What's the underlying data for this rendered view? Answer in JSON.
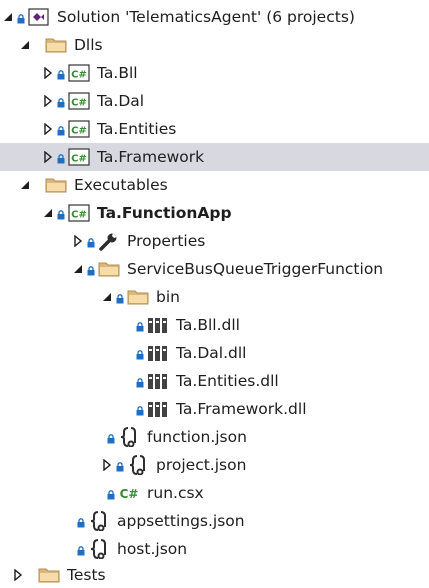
{
  "solution_explorer": {
    "items": [
      {
        "label": "Solution 'TelematicsAgent' (6 projects)",
        "icon": "visual-studio-solution-icon",
        "expander": "expanded",
        "lock": true
      },
      {
        "label": "Dlls",
        "icon": "folder-icon",
        "expander": "expanded",
        "lock": false
      },
      {
        "label": "Ta.Bll",
        "icon": "csharp-project-icon",
        "expander": "collapsed",
        "lock": true
      },
      {
        "label": "Ta.Dal",
        "icon": "csharp-project-icon",
        "expander": "collapsed",
        "lock": true
      },
      {
        "label": "Ta.Entities",
        "icon": "csharp-project-icon",
        "expander": "collapsed",
        "lock": true
      },
      {
        "label": "Ta.Framework",
        "icon": "csharp-project-icon",
        "expander": "collapsed",
        "lock": true,
        "selected": true
      },
      {
        "label": "Executables",
        "icon": "folder-icon",
        "expander": "expanded",
        "lock": false
      },
      {
        "label": "Ta.FunctionApp",
        "icon": "csharp-project-icon",
        "expander": "expanded",
        "lock": true,
        "bold": true
      },
      {
        "label": "Properties",
        "icon": "wrench-icon",
        "expander": "collapsed",
        "lock": true
      },
      {
        "label": "ServiceBusQueueTriggerFunction",
        "icon": "folder-icon",
        "expander": "expanded",
        "lock": true
      },
      {
        "label": "bin",
        "icon": "folder-icon",
        "expander": "expanded",
        "lock": true
      },
      {
        "label": "Ta.Bll.dll",
        "icon": "library-icon",
        "expander": "none",
        "lock": true
      },
      {
        "label": "Ta.Dal.dll",
        "icon": "library-icon",
        "expander": "none",
        "lock": true
      },
      {
        "label": "Ta.Entities.dll",
        "icon": "library-icon",
        "expander": "none",
        "lock": true
      },
      {
        "label": "Ta.Framework.dll",
        "icon": "library-icon",
        "expander": "none",
        "lock": true
      },
      {
        "label": "function.json",
        "icon": "json-file-icon",
        "expander": "none",
        "lock": true
      },
      {
        "label": "project.json",
        "icon": "json-file-icon",
        "expander": "collapsed",
        "lock": true
      },
      {
        "label": "run.csx",
        "icon": "csharp-file-icon",
        "expander": "none",
        "lock": true
      },
      {
        "label": "appsettings.json",
        "icon": "json-file-icon",
        "expander": "none",
        "lock": true
      },
      {
        "label": "host.json",
        "icon": "json-file-icon",
        "expander": "none",
        "lock": true
      },
      {
        "label": "Tests",
        "icon": "folder-icon",
        "expander": "collapsed",
        "lock": false
      }
    ]
  },
  "colors": {
    "selection": "#d7d8e0",
    "lock": "#1e6fc4",
    "csharp": "#388a34",
    "folder": "#dcb67a",
    "vs_purple": "#68217a"
  }
}
